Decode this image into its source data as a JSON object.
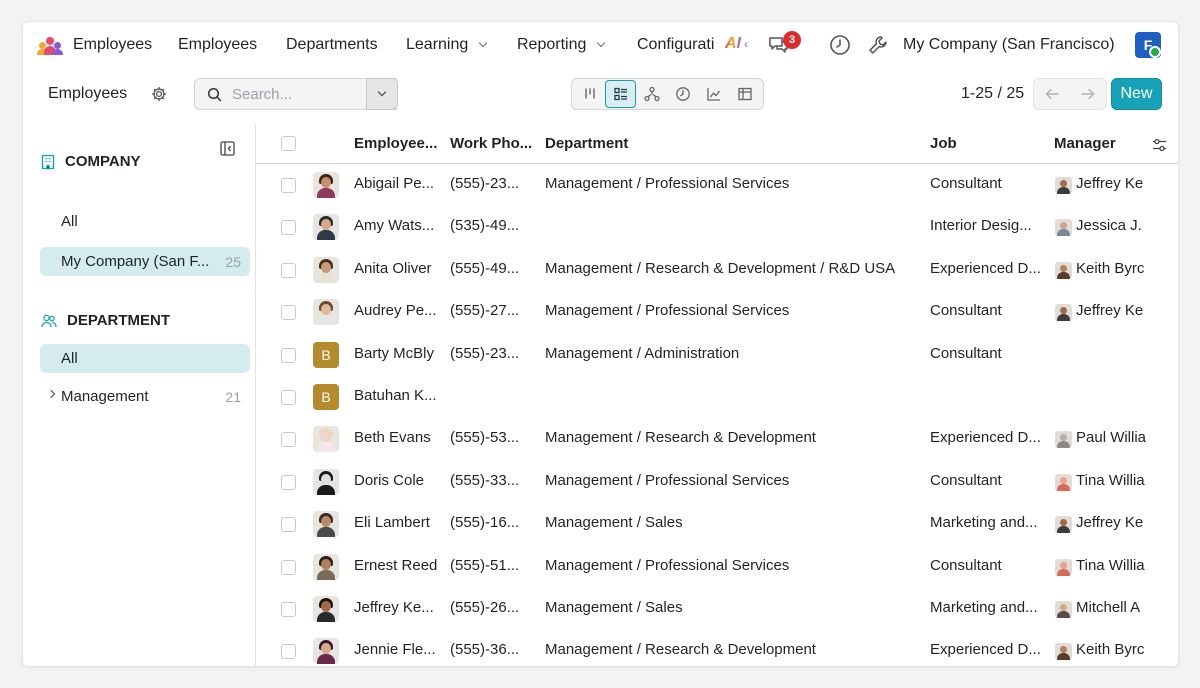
{
  "topnav": {
    "app_name": "Employees",
    "menu": [
      {
        "label": "Employees",
        "has_dropdown": false
      },
      {
        "label": "Departments",
        "has_dropdown": false
      },
      {
        "label": "Learning",
        "has_dropdown": true
      },
      {
        "label": "Reporting",
        "has_dropdown": true
      },
      {
        "label": "Configurati",
        "has_dropdown": false
      }
    ],
    "ai_label": "AI",
    "messages_badge": "3",
    "company": "My Company (San Francisco)",
    "user_initial": "F"
  },
  "control": {
    "breadcrumb": "Employees",
    "search_placeholder": "Search...",
    "pager": "1-25 / 25",
    "new_label": "New"
  },
  "sidebar": {
    "company_header": "COMPANY",
    "company_items": [
      {
        "label": "All",
        "count": "",
        "selected": false
      },
      {
        "label": "My Company (San F...",
        "count": "25",
        "selected": true
      }
    ],
    "department_header": "DEPARTMENT",
    "department_items": [
      {
        "label": "All",
        "count": "",
        "selected": true
      },
      {
        "label": "Management",
        "count": "21",
        "selected": false
      }
    ]
  },
  "table": {
    "columns": [
      "Employee...",
      "Work Pho...",
      "Department",
      "Job",
      "Manager"
    ],
    "rows": [
      {
        "name": "Abigail Pe...",
        "phone": "(555)-23...",
        "department": "Management / Professional Services",
        "job": "Consultant",
        "manager": "Jeffrey Ke",
        "avatar": "photo",
        "skin": "#c98e6e",
        "hair": "#3a2418",
        "shirt": "#8a3b5e",
        "msk": "#a56a48",
        "mshirt": "#3d3d3d"
      },
      {
        "name": "Amy Wats...",
        "phone": "(535)-49...",
        "department": "",
        "job": "Interior Desig...",
        "manager": "Jessica J.",
        "avatar": "photo",
        "skin": "#d7a98a",
        "hair": "#2b2b2b",
        "shirt": "#2d3a4a",
        "msk": "#c9a58c",
        "mshirt": "#7d8794"
      },
      {
        "name": "Anita Oliver",
        "phone": "(555)-49...",
        "department": "Management / Research & Development / R&D USA",
        "job": "Experienced D...",
        "manager": "Keith Byrc",
        "avatar": "photo",
        "skin": "#c89a78",
        "hair": "#4a2e1c",
        "shirt": "#e8e2d6",
        "msk": "#b67f5e",
        "mshirt": "#5a3a2a"
      },
      {
        "name": "Audrey Pe...",
        "phone": "(555)-27...",
        "department": "Management / Professional Services",
        "job": "Consultant",
        "manager": "Jeffrey Ke",
        "avatar": "photo",
        "skin": "#e0b89a",
        "hair": "#6b4a2e",
        "shirt": "#e6e6e6",
        "msk": "#a56a48",
        "mshirt": "#3d3d3d"
      },
      {
        "name": "Barty McBly",
        "phone": "(555)-23...",
        "department": "Management / Administration",
        "job": "Consultant",
        "manager": "",
        "avatar": "letter",
        "letter": "B"
      },
      {
        "name": "Batuhan K...",
        "phone": "",
        "department": "",
        "job": "",
        "manager": "",
        "avatar": "letter",
        "letter": "B"
      },
      {
        "name": "Beth Evans",
        "phone": "(555)-53...",
        "department": "Management / Research & Development",
        "job": "Experienced D...",
        "manager": "Paul Willia",
        "avatar": "photo",
        "skin": "#f0d4c4",
        "hair": "#f0d4c4",
        "shirt": "#f6e6ea",
        "msk": "#b8b0a8",
        "mshirt": "#8a8a8a"
      },
      {
        "name": "Doris Cole",
        "phone": "(555)-33...",
        "department": "Management / Professional Services",
        "job": "Consultant",
        "manager": "Tina Willia",
        "avatar": "photo",
        "skin": "#e0e0e0",
        "hair": "#1a1a1a",
        "shirt": "#1a1a1a",
        "msk": "#e8a090",
        "mshirt": "#d86a5a"
      },
      {
        "name": "Eli Lambert",
        "phone": "(555)-16...",
        "department": "Management / Sales",
        "job": "Marketing and...",
        "manager": "Jeffrey Ke",
        "avatar": "photo",
        "skin": "#b88a6a",
        "hair": "#3a2a20",
        "shirt": "#4a4a4a",
        "msk": "#a56a48",
        "mshirt": "#3d3d3d"
      },
      {
        "name": "Ernest Reed",
        "phone": "(555)-51...",
        "department": "Management / Professional Services",
        "job": "Consultant",
        "manager": "Tina Willia",
        "avatar": "photo",
        "skin": "#b08060",
        "hair": "#2a2018",
        "shirt": "#7a6a5a",
        "msk": "#e8a090",
        "mshirt": "#d86a5a"
      },
      {
        "name": "Jeffrey Ke...",
        "phone": "(555)-26...",
        "department": "Management / Sales",
        "job": "Marketing and...",
        "manager": "Mitchell A",
        "avatar": "photo",
        "skin": "#a56a48",
        "hair": "#1a1410",
        "shirt": "#2a2a2a",
        "msk": "#d4a88a",
        "mshirt": "#5a4a4a"
      },
      {
        "name": "Jennie Fle...",
        "phone": "(555)-36...",
        "department": "Management / Research & Development",
        "job": "Experienced D...",
        "manager": "Keith Byrc",
        "avatar": "photo",
        "skin": "#d8a890",
        "hair": "#3a1a2a",
        "shirt": "#6a2a4a",
        "msk": "#b67f5e",
        "mshirt": "#5a3a2a"
      }
    ]
  },
  "colors": {
    "accent": "#17a2b8",
    "selected_bg": "#d4ecf0",
    "badge": "#d92d2d",
    "letter_avatar": "#b58a2d"
  }
}
